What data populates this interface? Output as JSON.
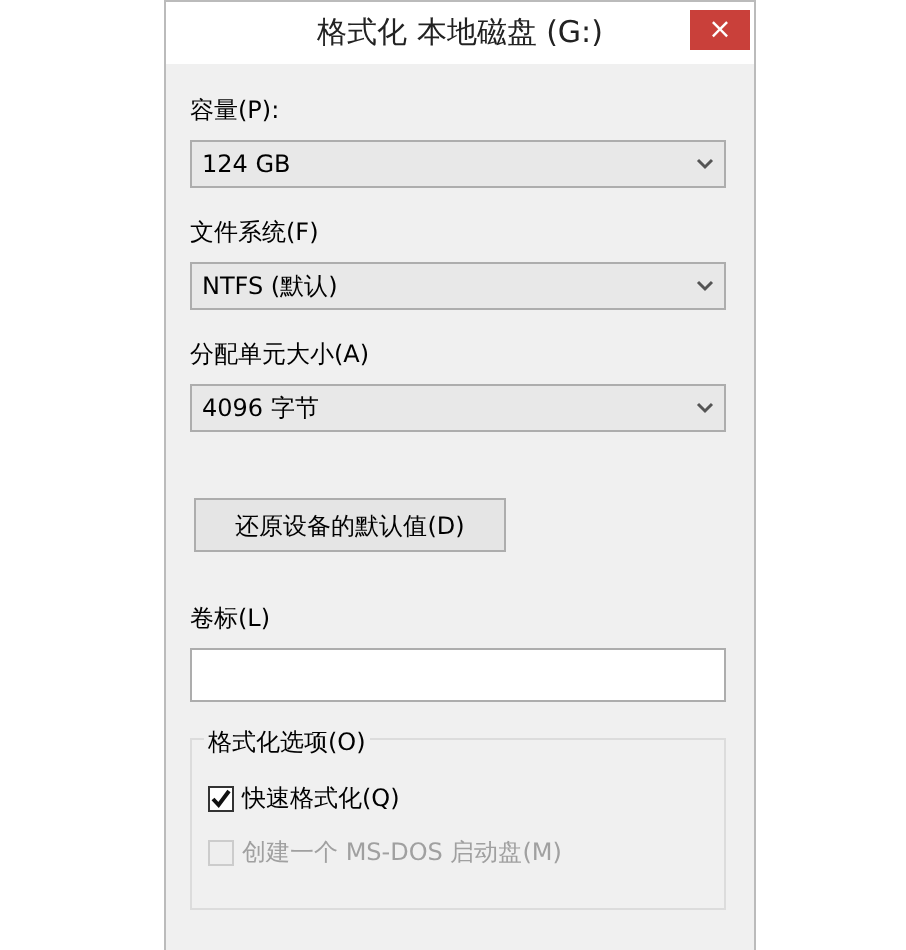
{
  "window": {
    "title": "格式化 本地磁盘 (G:)",
    "close": "×"
  },
  "fields": [
    {
      "label": "容量(P):",
      "value": "124 GB"
    },
    {
      "label": "文件系统(F)",
      "value": "NTFS (默认)"
    },
    {
      "label": "分配单元大小(A)",
      "value": "4096 字节"
    }
  ],
  "restore_button": "还原设备的默认值(D)",
  "volume_label": {
    "label": "卷标(L)"
  },
  "options": {
    "title": "格式化选项(O)",
    "items": [
      {
        "label": "快速格式化(Q)",
        "checked": true,
        "disabled": false
      },
      {
        "label": "创建一个 MS-DOS 启动盘(M)",
        "checked": false,
        "disabled": true
      }
    ]
  }
}
